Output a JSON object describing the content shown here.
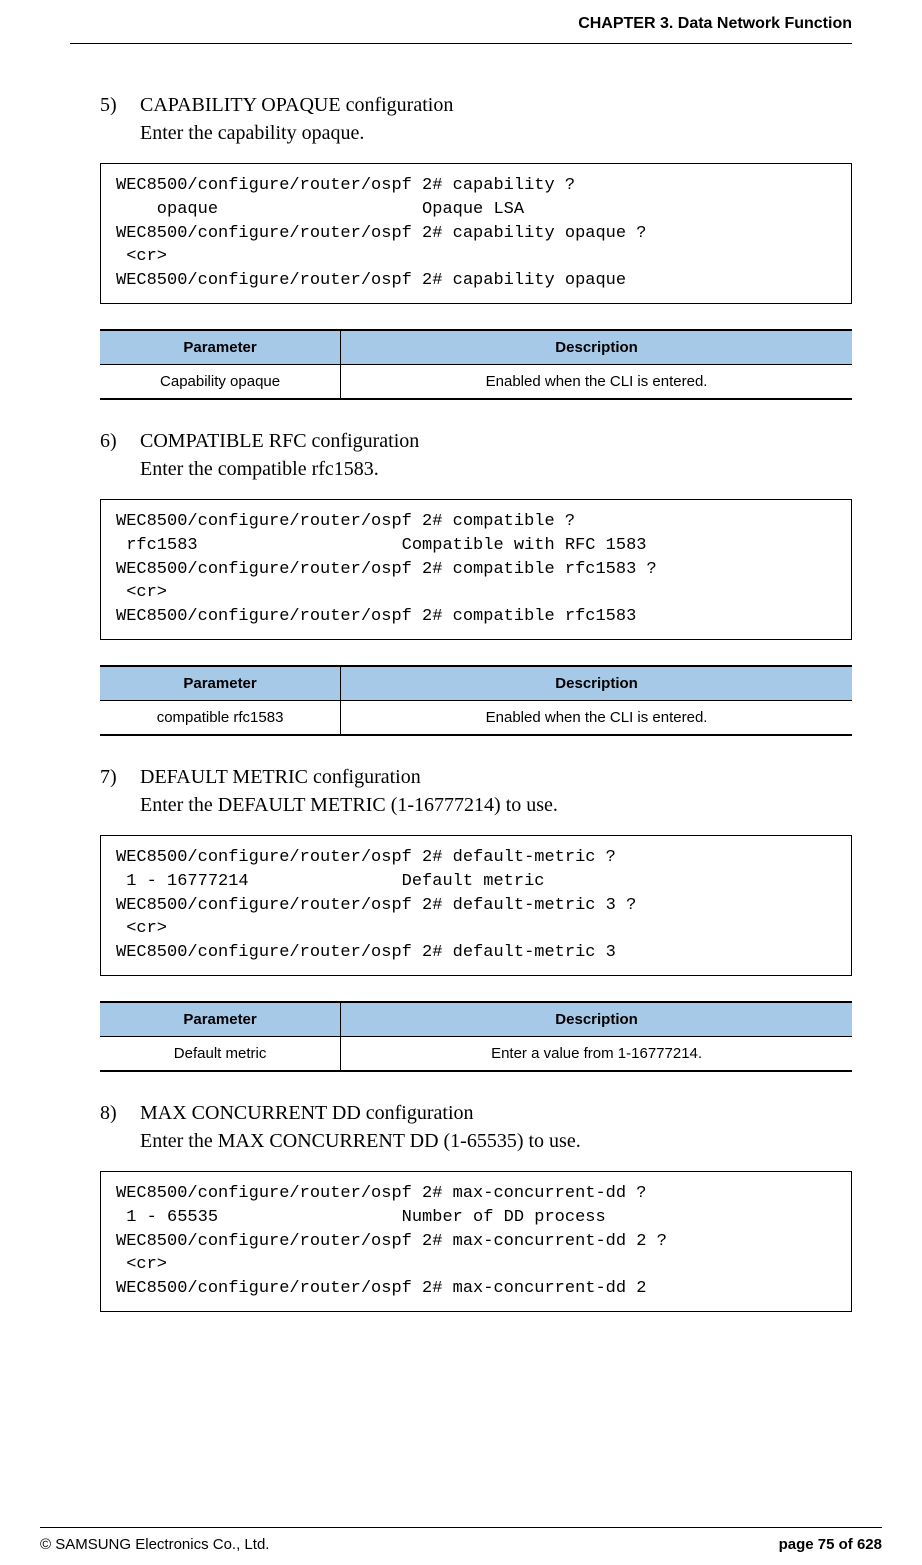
{
  "header": {
    "title": "CHAPTER 3. Data Network Function"
  },
  "sections": [
    {
      "number": "5)",
      "title": "CAPABILITY OPAQUE configuration",
      "desc": "Enter the capability opaque.",
      "code": "WEC8500/configure/router/ospf 2# capability ?\n    opaque                    Opaque LSA\nWEC8500/configure/router/ospf 2# capability opaque ?\n <cr>\nWEC8500/configure/router/ospf 2# capability opaque",
      "table": {
        "headers": [
          "Parameter",
          "Description"
        ],
        "rows": [
          [
            "Capability opaque",
            "Enabled when the CLI is entered."
          ]
        ]
      }
    },
    {
      "number": "6)",
      "title": "COMPATIBLE RFC configuration",
      "desc": "Enter the compatible rfc1583.",
      "code": "WEC8500/configure/router/ospf 2# compatible ?\n rfc1583                    Compatible with RFC 1583\nWEC8500/configure/router/ospf 2# compatible rfc1583 ?\n <cr>\nWEC8500/configure/router/ospf 2# compatible rfc1583",
      "table": {
        "headers": [
          "Parameter",
          "Description"
        ],
        "rows": [
          [
            "compatible rfc1583",
            "Enabled when the CLI is entered."
          ]
        ]
      }
    },
    {
      "number": "7)",
      "title": "DEFAULT METRIC configuration",
      "desc": "Enter the DEFAULT METRIC (1-16777214) to use.",
      "code": "WEC8500/configure/router/ospf 2# default-metric ?\n 1 - 16777214               Default metric\nWEC8500/configure/router/ospf 2# default-metric 3 ?\n <cr>\nWEC8500/configure/router/ospf 2# default-metric 3",
      "table": {
        "headers": [
          "Parameter",
          "Description"
        ],
        "rows": [
          [
            "Default metric",
            "Enter a value from 1-16777214."
          ]
        ]
      }
    },
    {
      "number": "8)",
      "title": "MAX CONCURRENT DD configuration",
      "desc": "Enter the MAX CONCURRENT DD (1-65535) to use.",
      "code": "WEC8500/configure/router/ospf 2# max-concurrent-dd ?\n 1 - 65535                  Number of DD process\nWEC8500/configure/router/ospf 2# max-concurrent-dd 2 ?\n <cr>\nWEC8500/configure/router/ospf 2# max-concurrent-dd 2",
      "table": null
    }
  ],
  "footer": {
    "left": "© SAMSUNG Electronics Co., Ltd.",
    "right": "page 75 of 628"
  }
}
